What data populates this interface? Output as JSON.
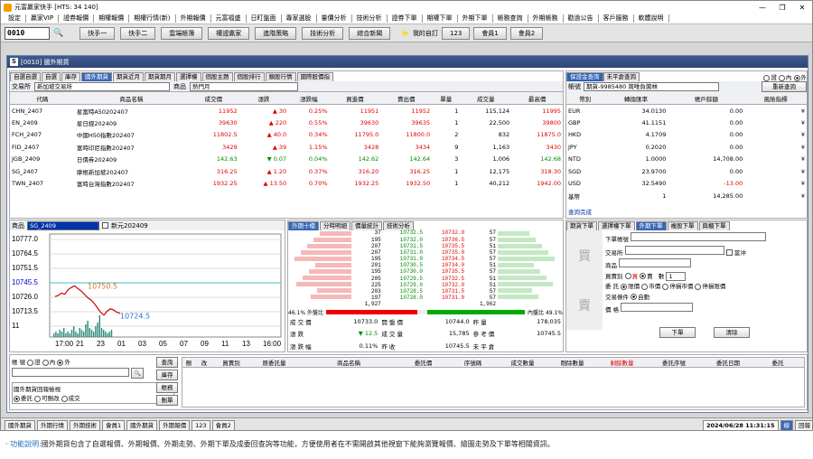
{
  "window": {
    "title": "元富贏家快手 [HTS: 34 140]",
    "min": "—",
    "max": "❐",
    "close": "✕"
  },
  "menu": [
    "設定",
    "贏家VIP",
    "證券報價",
    "期權報價",
    "期權行情(新)",
    "外期報價",
    "元富福盛",
    "日盯盤面",
    "專家選股",
    "量價分析",
    "技術分析",
    "證券下單",
    "期權下單",
    "外期下單",
    "帳務查詢",
    "外期帳務",
    "勸過公告",
    "客戶服務",
    "軟體說明"
  ],
  "toolbar": {
    "code": "0010",
    "buttons": [
      "快手一",
      "快手二",
      "雲端帳簿",
      "權證贏家",
      "進階策略",
      "技術分析",
      "綜合新聞"
    ],
    "fav": "我的自訂",
    "fav_num": "123",
    "b1": "會員1",
    "b2": "會員2"
  },
  "panel": {
    "title": "[0010] 國外期貨",
    "tabs": [
      "自選自選",
      "自選",
      "庫存",
      "國外期貨",
      "期貨近月",
      "期貨期月",
      "選擇權",
      "個股主題",
      "個股排行",
      "類股行情",
      "國際股價指"
    ],
    "active_tab": "國外期貨",
    "exchange_label": "交易所",
    "exchange_value": "新加坡交易所",
    "product_label": "商品",
    "product_value": "熱門月"
  },
  "quote_table": {
    "headers": [
      "代碼",
      "商品名稱",
      "成交價",
      "漲跌",
      "漲跌幅",
      "買進價",
      "賣出價",
      "單量",
      "成交量",
      "最高價"
    ],
    "rows": [
      {
        "code": "CHN_2407",
        "name": "星富時A50202407",
        "price": "11952",
        "dir": "▲",
        "chg": "30",
        "pct": "0.25%",
        "bid": "11951",
        "ask": "11952",
        "vol": "1",
        "total": "115,124",
        "high": "11995",
        "color": "red"
      },
      {
        "code": "EN_2409",
        "name": "星日經202409",
        "price": "39630",
        "dir": "▲",
        "chg": "220",
        "pct": "0.55%",
        "bid": "39630",
        "ask": "39635",
        "vol": "1",
        "total": "22,500",
        "high": "39800",
        "color": "red"
      },
      {
        "code": "FCH_2407",
        "name": "中國H50指數202407",
        "price": "11802.5",
        "dir": "▲",
        "chg": "40.0",
        "pct": "0.34%",
        "bid": "11795.0",
        "ask": "11800.0",
        "vol": "2",
        "total": "832",
        "high": "11875.0",
        "color": "red"
      },
      {
        "code": "FID_2407",
        "name": "富時印尼指數202407",
        "price": "3429",
        "dir": "▲",
        "chg": "39",
        "pct": "1.15%",
        "bid": "3428",
        "ask": "3434",
        "vol": "9",
        "total": "1,163",
        "high": "3430",
        "color": "red"
      },
      {
        "code": "JGB_2409",
        "name": "日債券202409",
        "price": "142.63",
        "dir": "▼",
        "chg": "0.07",
        "pct": "0.04%",
        "bid": "142.62",
        "ask": "142.64",
        "vol": "3",
        "total": "1,006",
        "high": "142.68",
        "color": "grn"
      },
      {
        "code": "SG_2407",
        "name": "摩根新加坡202407",
        "price": "316.25",
        "dir": "▲",
        "chg": "1.20",
        "pct": "0.37%",
        "bid": "316.20",
        "ask": "316.25",
        "vol": "1",
        "total": "12,175",
        "high": "318.30",
        "color": "red"
      },
      {
        "code": "TWN_2407",
        "name": "富時台灣指數202407",
        "price": "1932.25",
        "dir": "▲",
        "chg": "13.50",
        "pct": "0.70%",
        "bid": "1932.25",
        "ask": "1932.50",
        "vol": "1",
        "total": "40,212",
        "high": "1942.00",
        "color": "red"
      }
    ]
  },
  "account": {
    "tabs": [
      "保證金查詢",
      "未平倉查詢"
    ],
    "radios": [
      "證",
      "內",
      "外"
    ],
    "label": "帳號",
    "account_value": "期貨-9985480 周唯負菌林",
    "refresh": "重新查詢",
    "headers": [
      "幣別",
      "轉換匯率",
      "帳戶餘額",
      "風險指標"
    ],
    "rows": [
      [
        "EUR",
        "34.0130",
        "0.00",
        "¥"
      ],
      [
        "GBP",
        "41.1151",
        "0.00",
        "¥"
      ],
      [
        "HKD",
        "4.1709",
        "0.00",
        "¥"
      ],
      [
        "JPY",
        "0.2020",
        "0.00",
        "¥"
      ],
      [
        "NTD",
        "1.0000",
        "14,708.00",
        "¥"
      ],
      [
        "SGD",
        "23.9700",
        "0.00",
        "¥"
      ],
      [
        "USD",
        "32.5490",
        "-13.00",
        "¥"
      ],
      [
        "基幣",
        "1",
        "14,285.00",
        "¥"
      ]
    ],
    "done": "查詢完成"
  },
  "chart_head": {
    "label": "商品",
    "product": "SG_2409",
    "name": "新元202409"
  },
  "chart_data": {
    "type": "line",
    "ylabels": [
      "10777.0",
      "10764.5",
      "10751.5",
      "10745.5",
      "10726.0",
      "10713.5",
      "11"
    ],
    "xlabels": [
      "17:00",
      "21",
      "23",
      "01",
      "03",
      "05",
      "07",
      "09",
      "11",
      "13",
      "16:00"
    ],
    "annot_high": "10750.5",
    "annot_low": "10724.5",
    "line": [
      10741,
      10742,
      10744,
      10743,
      10747,
      10749,
      10750.5,
      10748,
      10746,
      10743,
      10740,
      10738,
      10735,
      10731,
      10727,
      10724.5,
      10728,
      10730,
      10729,
      10727,
      10726
    ],
    "ylim": [
      10705,
      10780
    ],
    "volumes": [
      2,
      3,
      2,
      4,
      3,
      5,
      2,
      3,
      2,
      4,
      6,
      3,
      2,
      5,
      4,
      3,
      7,
      9,
      5,
      4,
      3,
      6,
      8,
      12,
      5,
      4,
      3,
      2,
      3,
      4
    ]
  },
  "ticks": {
    "tabs": [
      "外期十檔",
      "分時明細",
      "價量統計",
      "技術分析"
    ],
    "bid_vol": [
      "",
      "",
      "",
      "",
      "",
      "",
      "",
      "",
      "",
      "",
      "",
      ""
    ],
    "rows": [
      [
        "37",
        "10732.5",
        "10732.0",
        "57"
      ],
      [
        "195",
        "10732.0",
        "10736.5",
        "57"
      ],
      [
        "207",
        "10731.5",
        "10735.5",
        "51"
      ],
      [
        "207",
        "10731.0",
        "10735.0",
        "57"
      ],
      [
        "195",
        "10731.0",
        "10734.5",
        "57"
      ],
      [
        "201",
        "10730.5",
        "10734.0",
        "51"
      ],
      [
        "195",
        "10730.0",
        "10735.5",
        "57"
      ],
      [
        "205",
        "10729.5",
        "10732.5",
        "51"
      ],
      [
        "225",
        "10729.0",
        "10732.0",
        "51"
      ],
      [
        "203",
        "10728.5",
        "10731.5",
        "57"
      ],
      [
        "197",
        "10728.0",
        "10731.0",
        "57"
      ],
      [
        "1,927",
        "",
        "",
        "1,962"
      ]
    ],
    "out_pct": "46.1% 外盤比",
    "in_pct": "內盤比 49.1%",
    "info": [
      [
        "成 交 價",
        "10733.0",
        "開 盤 價",
        "10744.0",
        "昨 量",
        "178,035"
      ],
      [
        "漲 跌",
        "▼ 12.5",
        "成 交 量",
        "15,785",
        "參 考 價",
        "10745.5"
      ],
      [
        "漲 跌 幅",
        "0.11%",
        "昨 收",
        "10745.5",
        "未 平 倉",
        ""
      ]
    ]
  },
  "order": {
    "tabs": [
      "期貨下單",
      "選擇權下單",
      "外期下單",
      "複股下單",
      "興櫃下單"
    ],
    "active": "外期下單",
    "account_label": "下單帳號",
    "exchange_label": "交易所",
    "spread_label": "當沖",
    "product_label": "商品",
    "bs_label": "買賣別",
    "buy": "買",
    "sell": "賣",
    "qty_label": "數",
    "qty": "1",
    "type_label": "委 託",
    "types": [
      "限價",
      "市價",
      "停損市價",
      "停損限價"
    ],
    "cond_label": "交易條件",
    "cond": "自動",
    "price_label": "價 格",
    "side_buy": "買",
    "side_sell": "賣",
    "submit": "下單",
    "clear": "清除"
  },
  "bottom": {
    "account_label": "帳 號",
    "radios": [
      "證",
      "內",
      "外"
    ],
    "search": "🔍",
    "btns": [
      "查詢",
      "庫存",
      "帳務",
      "刪單"
    ],
    "filter_label": "國外期貨回報檢視",
    "filters": [
      "委託",
      "可刪改",
      "成交"
    ],
    "headers": [
      "刪",
      "改",
      "買賣別",
      "原委託量",
      "商品名稱",
      "委託價",
      "序號碼",
      "成交數量",
      "剛除數量",
      "剩餘數量",
      "委託序號",
      "委託日期",
      "委託"
    ]
  },
  "status": {
    "btns": [
      "國外期貨",
      "外期行情",
      "外期技術",
      "會員1",
      "國外期貨",
      "外期報價",
      "123",
      "會員2"
    ],
    "datetime": "2024/06/28 11:31:15",
    "conn": "線",
    "reply": "回報"
  },
  "caption": {
    "label": "功能說明:",
    "text": "國外期貨包含了自選報價、外期報價、外期走勢、外期下單及成委回查詢等功能，方便使用者在不需開啟其他視窗下能夠瀏覽報價、繪圖走勢及下單等相關資訊。"
  }
}
